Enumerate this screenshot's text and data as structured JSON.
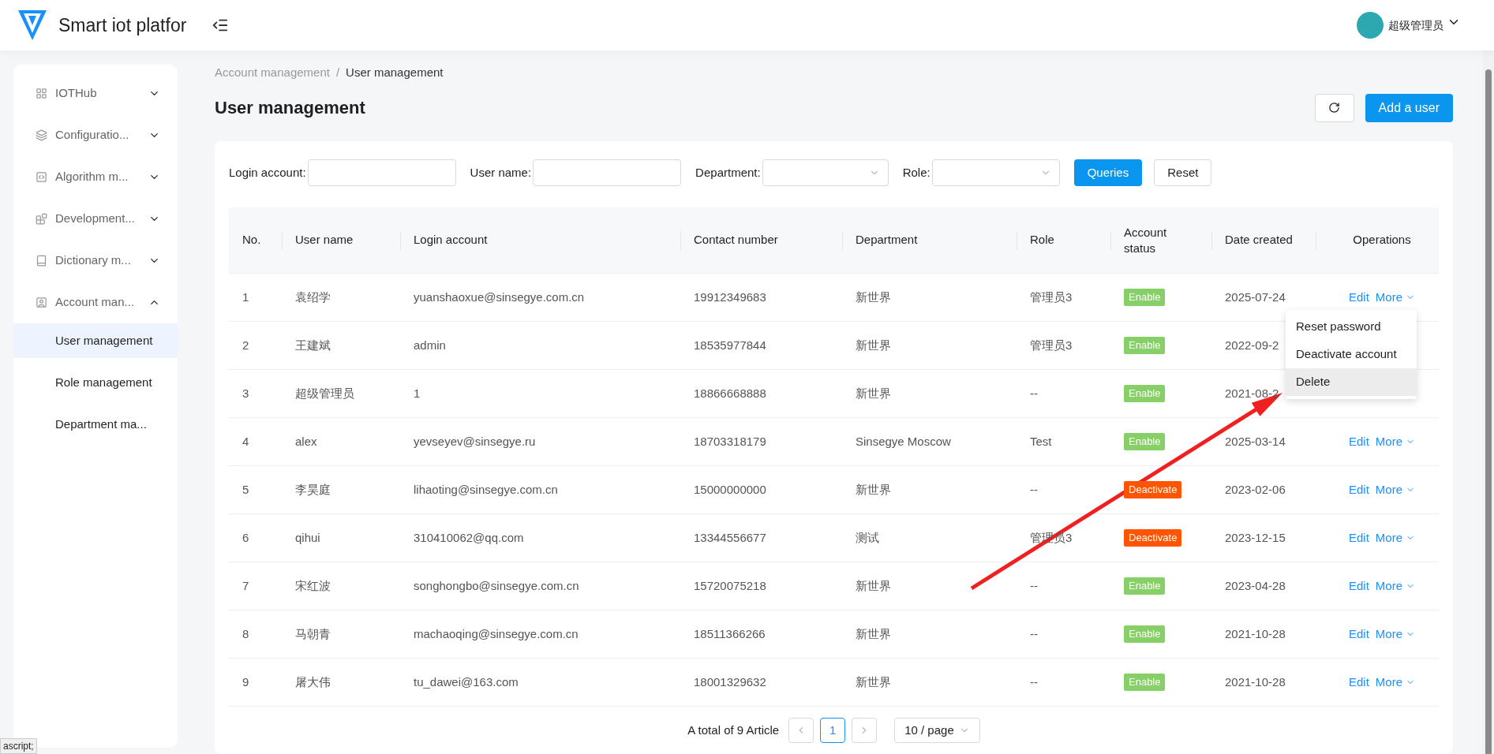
{
  "header": {
    "title": "Smart iot platfor",
    "user": "超级管理员"
  },
  "sidebar": {
    "items": [
      {
        "label": "IOTHub",
        "expanded": false
      },
      {
        "label": "Configuratio...",
        "expanded": false
      },
      {
        "label": "Algorithm m...",
        "expanded": false
      },
      {
        "label": "Development...",
        "expanded": false
      },
      {
        "label": "Dictionary m...",
        "expanded": false
      },
      {
        "label": "Account man...",
        "expanded": true,
        "children": [
          {
            "label": "User management",
            "selected": true
          },
          {
            "label": "Role management",
            "selected": false
          },
          {
            "label": "Department ma...",
            "selected": false
          }
        ]
      }
    ]
  },
  "breadcrumb": {
    "items": [
      "Account management",
      "User management"
    ],
    "separator": "/"
  },
  "page_title": "User management",
  "add_button": "Add a user",
  "filters": [
    {
      "label": "Login account:",
      "kind": "input"
    },
    {
      "label": "User name:",
      "kind": "input"
    },
    {
      "label": "Department:",
      "kind": "select"
    },
    {
      "label": "Role:",
      "kind": "select"
    }
  ],
  "query_button": "Queries",
  "reset_button": "Reset",
  "table": {
    "columns": [
      "No.",
      "User name",
      "Login account",
      "Contact number",
      "Department",
      "Role",
      "Account status",
      "Date created",
      "Operations"
    ],
    "rows": [
      {
        "no": "1",
        "name": "袁绍学",
        "account": "yuanshaoxue@sinsegye.com.cn",
        "phone": "19912349683",
        "dept": "新世界",
        "role": "管理员3",
        "status": {
          "text": "Enable",
          "color": "#87d068"
        },
        "date": "2025-07-24",
        "edit": "Edit",
        "more": "More"
      },
      {
        "no": "2",
        "name": "王建斌",
        "account": "admin",
        "phone": "18535977844",
        "dept": "新世界",
        "role": "管理员3",
        "status": {
          "text": "Enable",
          "color": "#87d068"
        },
        "date": "2022-09-2"
      },
      {
        "no": "3",
        "name": "超级管理员",
        "account": "1",
        "phone": "18866668888",
        "dept": "新世界",
        "role": "--",
        "status": {
          "text": "Enable",
          "color": "#87d068"
        },
        "date": "2021-08-2"
      },
      {
        "no": "4",
        "name": "alex",
        "account": "yevseyev@sinsegye.ru",
        "phone": "18703318179",
        "dept": "Sinsegye Moscow",
        "role": "Test",
        "status": {
          "text": "Enable",
          "color": "#87d068"
        },
        "date": "2025-03-14",
        "edit": "Edit",
        "more": "More"
      },
      {
        "no": "5",
        "name": "李昊庭",
        "account": "lihaoting@sinsegye.com.cn",
        "phone": "15000000000",
        "dept": "新世界",
        "role": "--",
        "status": {
          "text": "Deactivate",
          "color": "#ff5500"
        },
        "date": "2023-02-06",
        "edit": "Edit",
        "more": "More"
      },
      {
        "no": "6",
        "name": "qihui",
        "account": "310410062@qq.com",
        "phone": "13344556677",
        "dept": "测试",
        "role": "管理员3",
        "status": {
          "text": "Deactivate",
          "color": "#ff5500"
        },
        "date": "2023-12-15",
        "edit": "Edit",
        "more": "More"
      },
      {
        "no": "7",
        "name": "宋红波",
        "account": "songhongbo@sinsegye.com.cn",
        "phone": "15720075218",
        "dept": "新世界",
        "role": "--",
        "status": {
          "text": "Enable",
          "color": "#87d068"
        },
        "date": "2023-04-28",
        "edit": "Edit",
        "more": "More"
      },
      {
        "no": "8",
        "name": "马朝青",
        "account": "machaoqing@sinsegye.com.cn",
        "phone": "18511366266",
        "dept": "新世界",
        "role": "--",
        "status": {
          "text": "Enable",
          "color": "#87d068"
        },
        "date": "2021-10-28",
        "edit": "Edit",
        "more": "More"
      },
      {
        "no": "9",
        "name": "屠大伟",
        "account": "tu_dawei@163.com",
        "phone": "18001329632",
        "dept": "新世界",
        "role": "--",
        "status": {
          "text": "Enable",
          "color": "#87d068"
        },
        "date": "2021-10-28",
        "edit": "Edit",
        "more": "More"
      }
    ]
  },
  "menu": {
    "items": [
      {
        "label": "Reset password",
        "selected": false
      },
      {
        "label": "Deactivate account",
        "selected": false
      },
      {
        "label": "Delete",
        "selected": true
      }
    ]
  },
  "pagination": {
    "total": "A total of 9 Article",
    "pages": [
      {
        "label": "1",
        "selected": true
      }
    ],
    "page_size": "10 / page"
  },
  "status_bar": "ascript;"
}
